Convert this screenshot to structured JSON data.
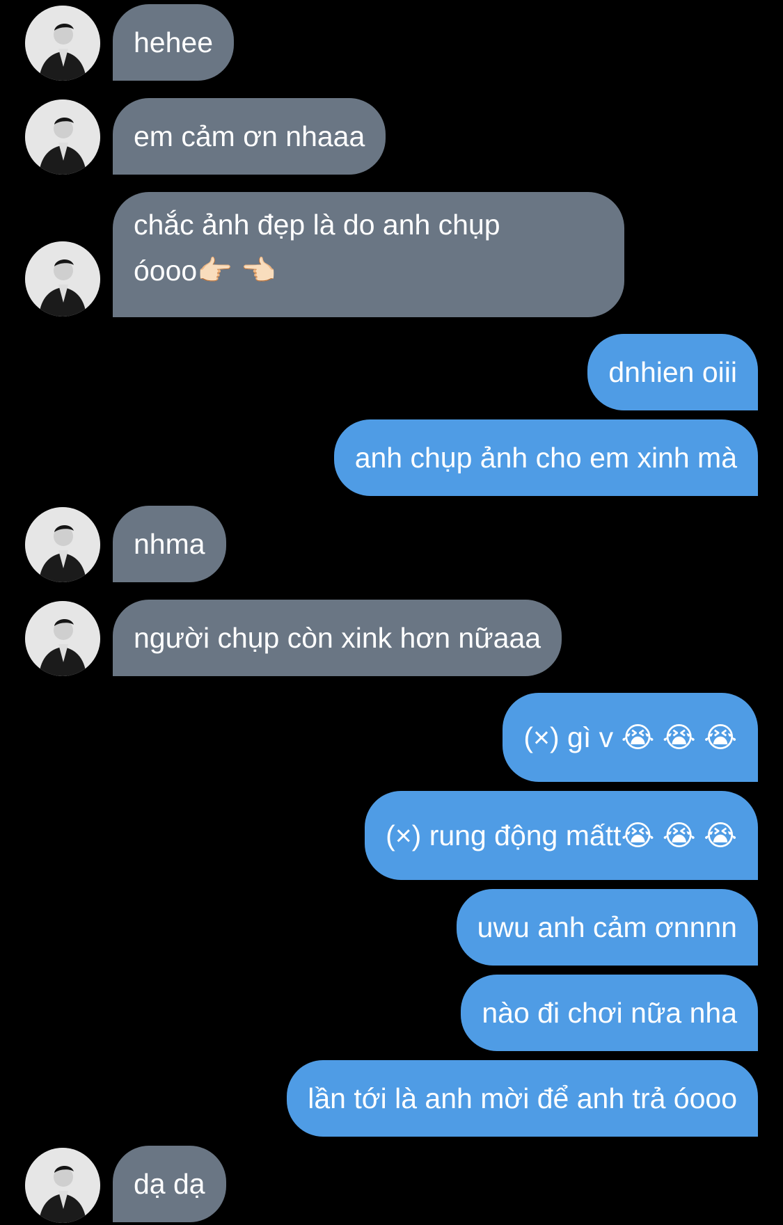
{
  "conversation": {
    "messages": [
      {
        "direction": "in",
        "text": "hehee"
      },
      {
        "direction": "in",
        "text": "em cảm ơn nhaaa"
      },
      {
        "direction": "in",
        "text": "chắc ảnh đẹp là do anh chụp óooo👉🏻 👈🏻"
      },
      {
        "direction": "out",
        "text": "dnhien oiii"
      },
      {
        "direction": "out",
        "text": "anh chụp ảnh cho em xinh mà"
      },
      {
        "direction": "in",
        "text": "nhma"
      },
      {
        "direction": "in",
        "text": "người chụp còn xink hơn nữaaa"
      },
      {
        "direction": "out",
        "text": "(×) gì v 😭 😭 😭"
      },
      {
        "direction": "out",
        "text": "(×) rung động mấtt😭 😭 😭"
      },
      {
        "direction": "out",
        "text": "uwu anh cảm ơnnnn"
      },
      {
        "direction": "out",
        "text": "nào đi chơi nữa nha"
      },
      {
        "direction": "out",
        "text": "lần tới là anh mời để anh trả óooo"
      },
      {
        "direction": "in",
        "text": "dạ dạ"
      }
    ]
  },
  "colors": {
    "background": "#000000",
    "incoming_bubble": "#6a7684",
    "outgoing_bubble": "#4f9ce5",
    "text": "#ffffff"
  },
  "icons": {
    "avatar": "profile-photo-grayscale"
  }
}
